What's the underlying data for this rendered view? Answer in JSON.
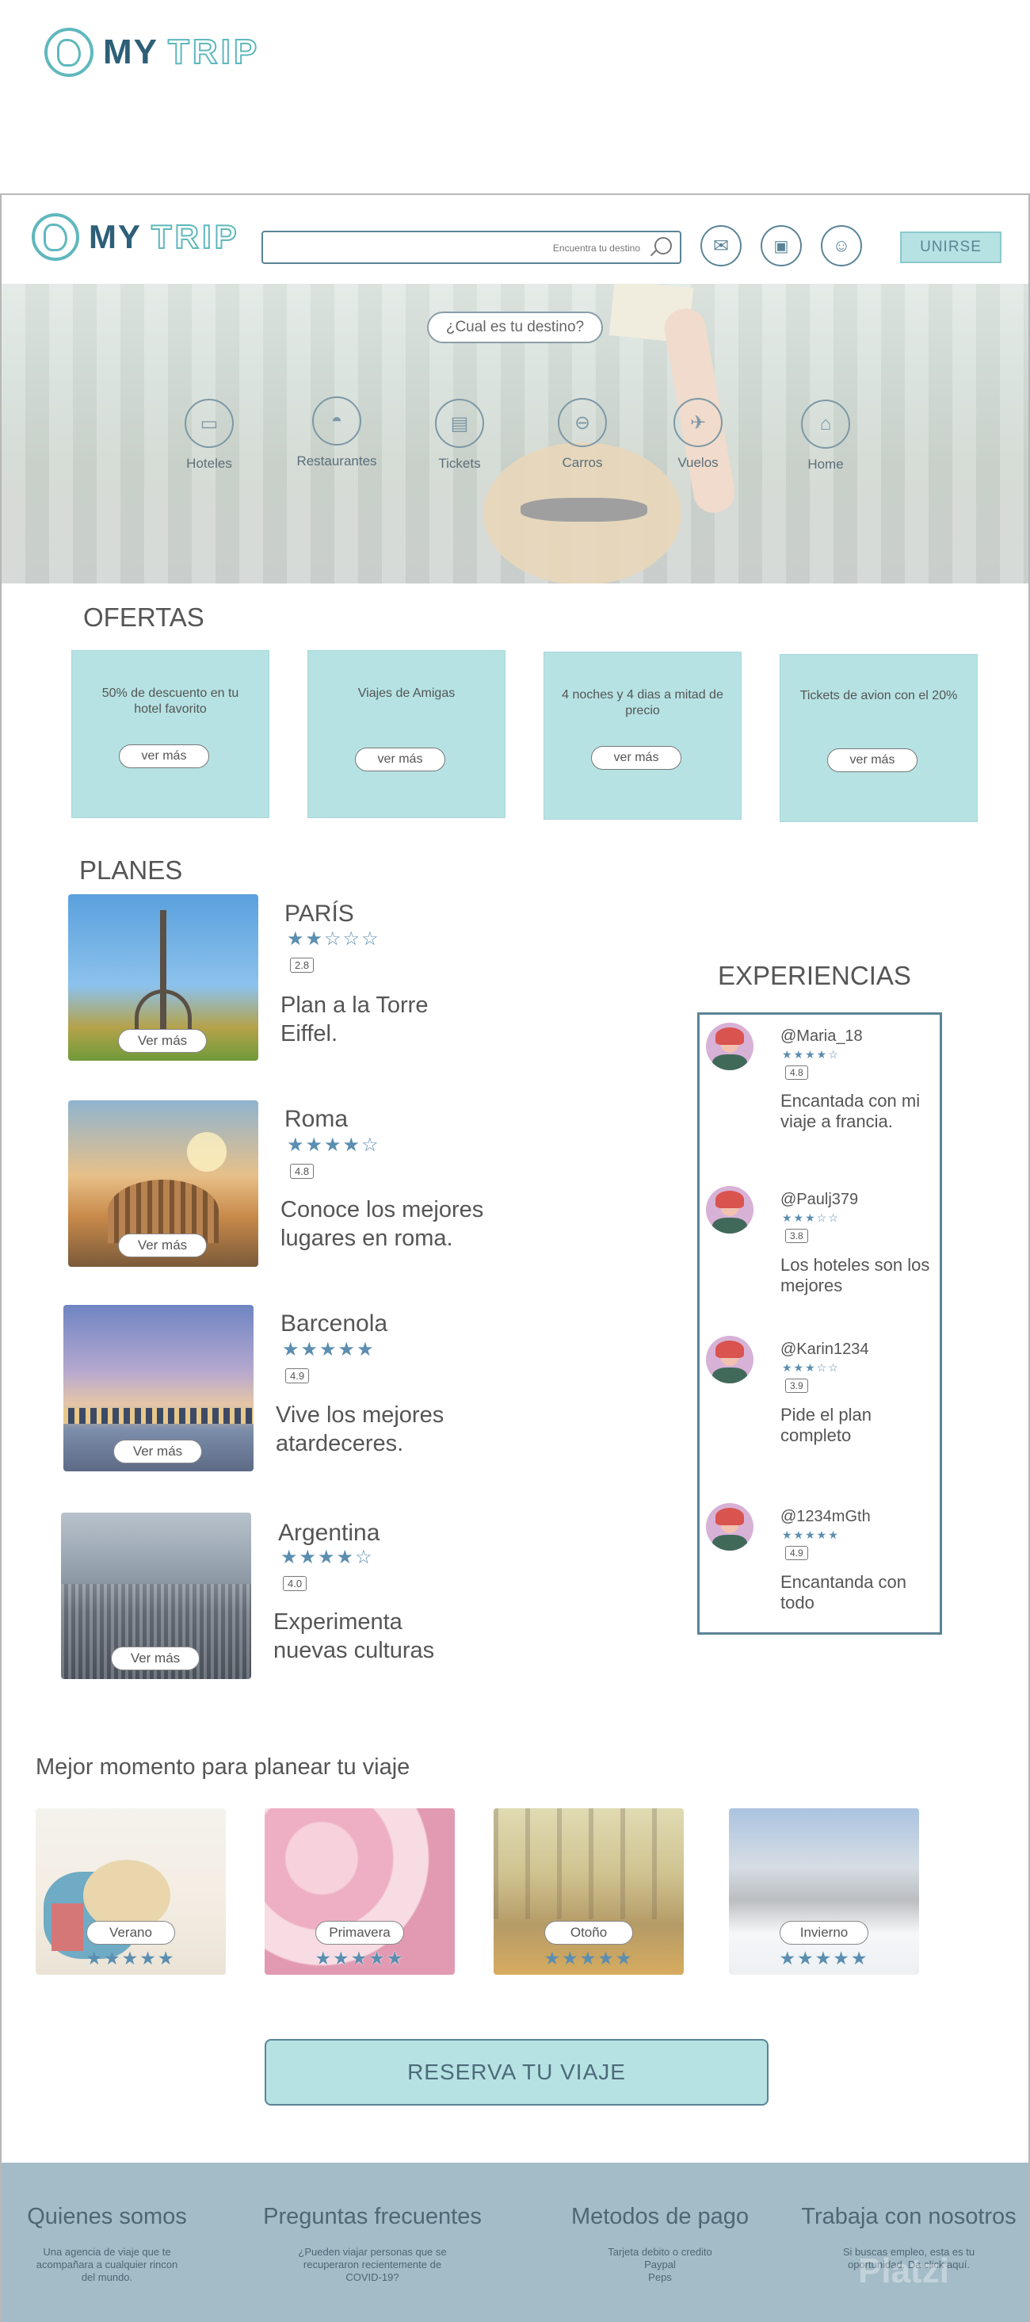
{
  "brand": {
    "word1": "MY",
    "word2": "TRIP"
  },
  "search": {
    "placeholder": "Encuentra tu destino"
  },
  "header": {
    "join_label": "UNIRSE"
  },
  "hero": {
    "question": "¿Cual es tu destino?"
  },
  "categories": [
    {
      "label": "Hoteles",
      "icon": "bed-icon"
    },
    {
      "label": "Restaurantes",
      "icon": "cloche-icon"
    },
    {
      "label": "Tickets",
      "icon": "ticket-icon"
    },
    {
      "label": "Carros",
      "icon": "car-icon"
    },
    {
      "label": "Vuelos",
      "icon": "plane-icon"
    },
    {
      "label": "Home",
      "icon": "house-icon"
    }
  ],
  "ofertas": {
    "title": "OFERTAS",
    "items": [
      {
        "text": "50% de descuento en tu hotel favorito",
        "button": "ver más"
      },
      {
        "text": "Viajes de Amigas",
        "button": "ver más"
      },
      {
        "text": "4 noches y 4 dias a mitad de precio",
        "button": "ver más"
      },
      {
        "text": "Tickets de avion con el 20%",
        "button": "ver más"
      }
    ]
  },
  "planes": {
    "title": "PLANES",
    "items": [
      {
        "name": "PARÍS",
        "stars": "★★☆☆☆",
        "rating": "2.8",
        "desc": "Plan a la Torre Eiffel.",
        "button": "Ver más"
      },
      {
        "name": "Roma",
        "stars": "★★★★☆",
        "rating": "4.8",
        "desc": "Conoce los mejores lugares en roma.",
        "button": "Ver más"
      },
      {
        "name": "Barcenola",
        "stars": "★★★★★",
        "rating": "4.9",
        "desc": "Vive los mejores atardeceres.",
        "button": "Ver más"
      },
      {
        "name": "Argentina",
        "stars": "★★★★☆",
        "rating": "4.0",
        "desc": "Experimenta nuevas culturas",
        "button": "Ver más"
      }
    ]
  },
  "experiencias": {
    "title": "EXPERIENCIAS",
    "items": [
      {
        "user": "@Maria_18",
        "stars": "★★★★☆",
        "rating": "4.8",
        "comment": "Encantada con mi viaje a francia."
      },
      {
        "user": "@Paulj379",
        "stars": "★★★☆☆",
        "rating": "3.8",
        "comment": "Los hoteles son los mejores"
      },
      {
        "user": "@Karin1234",
        "stars": "★★★☆☆",
        "rating": "3.9",
        "comment": "Pide  el plan completo"
      },
      {
        "user": "@1234mGth",
        "stars": "★★★★★",
        "rating": "4.9",
        "comment": "Encantanda con todo"
      }
    ]
  },
  "temporadas": {
    "title": "Mejor momento para planear tu viaje",
    "items": [
      {
        "name": "Verano",
        "stars": "★★★★★"
      },
      {
        "name": "Primavera",
        "stars": "★★★★★"
      },
      {
        "name": "Otoño",
        "stars": "★★★★★"
      },
      {
        "name": "Invierno",
        "stars": "★★★★★"
      }
    ]
  },
  "cta": {
    "label": "RESERVA TU VIAJE"
  },
  "footer": {
    "cols": [
      {
        "title": "Quienes somos",
        "text": "Una agencia de viaje que te acompañara a cualquier rincon del mundo."
      },
      {
        "title": "Preguntas frecuentes",
        "text": "¿Pueden viajar personas que se recuperaron recientemente de COVID-19?"
      },
      {
        "title": "Metodos de pago",
        "text": "Tarjeta debito o credito\nPaypal\nPeps"
      },
      {
        "title": "Trabaja con nosotros",
        "text": "Si buscas empleo, esta es tu oportunidad. Da click aquí."
      }
    ],
    "watermark": "Platzi"
  },
  "colors": {
    "accent": "#b6e2e3",
    "dark": "#5b8497",
    "star": "#5b8eb0"
  }
}
